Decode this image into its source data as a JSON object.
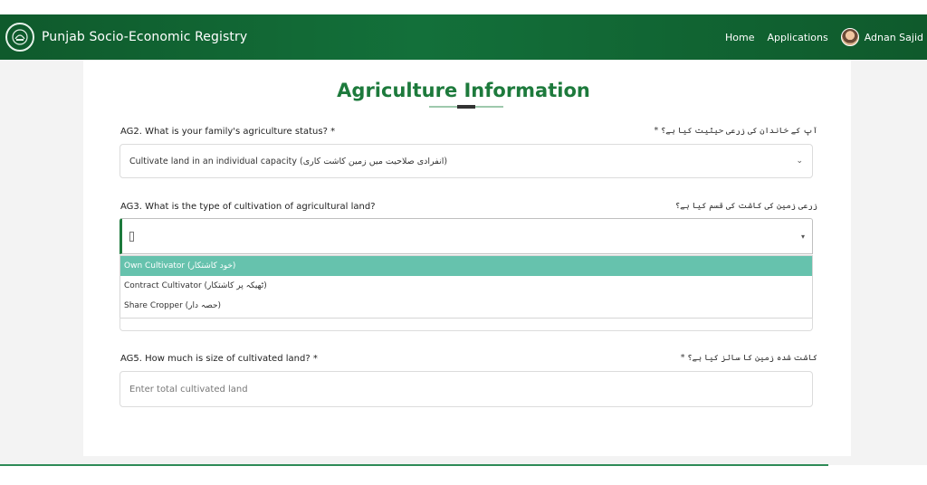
{
  "header": {
    "brand": "Punjab Socio-Economic Registry",
    "nav": {
      "home": "Home",
      "applications": "Applications"
    },
    "user_name": "Adnan Sajid"
  },
  "form": {
    "title": "Agriculture Information",
    "ag2": {
      "label": "AG2. What is your family's agriculture status? *",
      "urdu": "آپ کے خاندان کی زرعی حیثیت کیا ہے؟ *",
      "selected": "Cultivate land in an individual capacity (انفرادی صلاحیت میں زمین کاشت کاری)"
    },
    "ag3": {
      "label": "AG3. What is the type of cultivation of agricultural land?",
      "urdu": "زرعی زمین کی کاشت کی قسم کیا ہے؟",
      "options": [
        "Own Cultivator (خود کاشتکار)",
        "Contract Cultivator (ٹھیکہ پر کاشتکار)",
        "Share Cropper (حصہ دار)"
      ]
    },
    "ag5": {
      "label": "AG5. How much is size of cultivated land? *",
      "urdu": "کاشت شدہ زمین کا سائز کیا ہے؟ *",
      "placeholder": "Enter total cultivated land"
    }
  },
  "colors": {
    "brand_green": "#0f5a2c",
    "accent_green": "#1d7a3c",
    "option_highlight": "#66c2ad"
  }
}
